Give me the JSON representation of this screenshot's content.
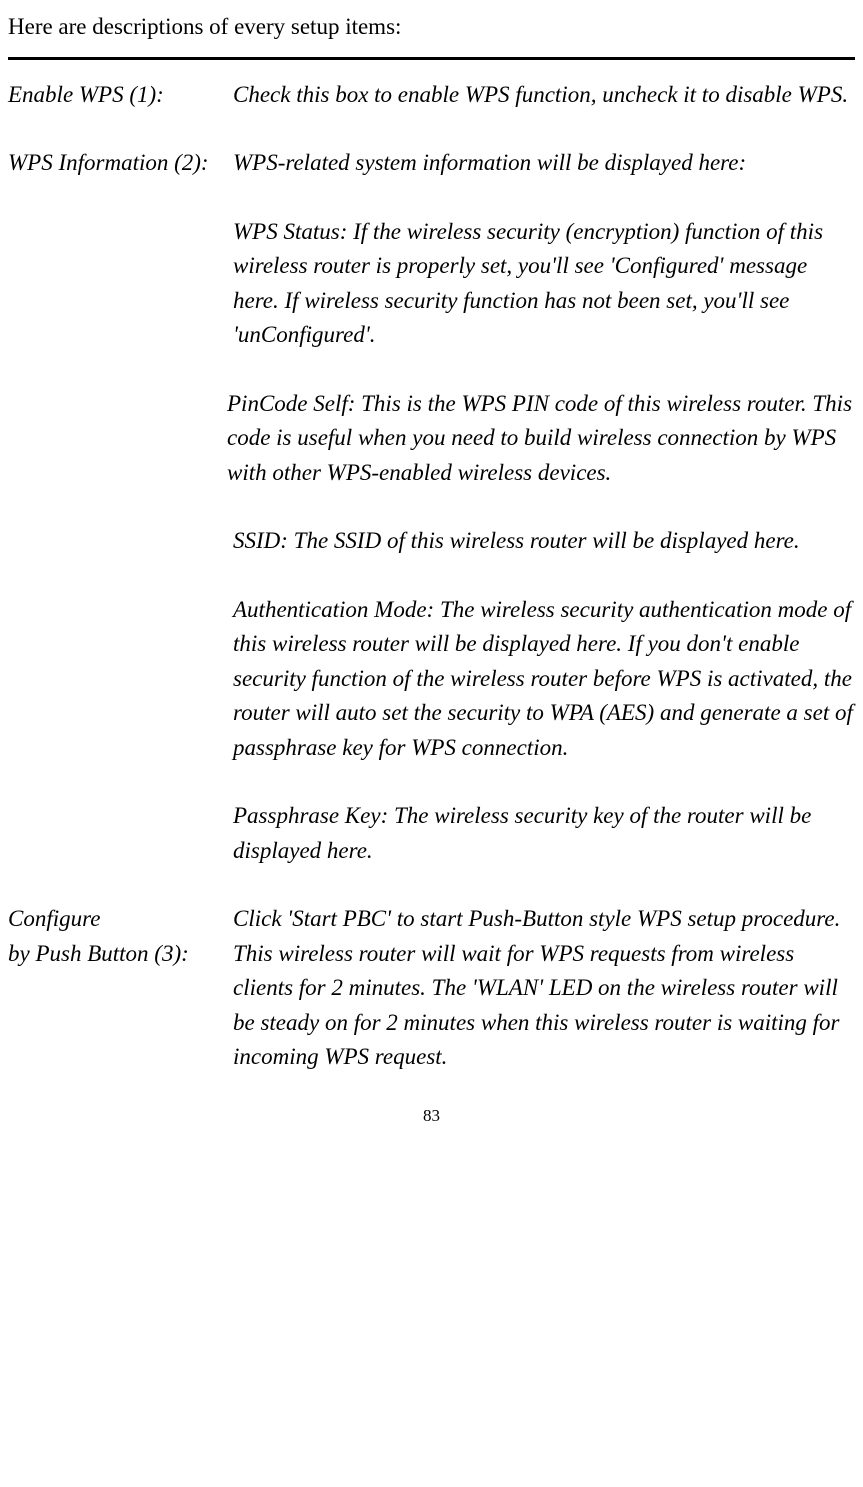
{
  "intro": "Here are descriptions of every setup items:",
  "items": [
    {
      "term": "Enable WPS (1):",
      "def": "Check this box to enable WPS function, uncheck it to disable WPS."
    },
    {
      "term": "WPS Information (2):",
      "def": "WPS-related system information will be displayed here:",
      "subs": [
        "WPS Status: If the wireless security (encryption) function of this wireless router is properly set, you'll see 'Configured' message here. If wireless security function has not been set, you'll see 'unConfigured'.",
        "PinCode Self: This is the WPS PIN code of this wireless router. This code is useful when you need to build wireless connection by WPS with other WPS-enabled wireless devices.",
        "SSID: The SSID of this wireless router will be displayed here.",
        "Authentication Mode: The wireless security authentication mode of this wireless router will be displayed here. If you don't enable security function of the wireless router before WPS is activated, the router will auto set the security to WPA (AES) and generate a set of passphrase key for WPS connection.",
        "Passphrase Key: The wireless security key of the router will be displayed here."
      ]
    },
    {
      "term_lines": [
        "Configure",
        "by Push Button (3):"
      ],
      "def": "Click 'Start PBC' to start Push-Button style WPS setup procedure. This wireless router will wait for WPS requests from wireless clients for 2 minutes. The 'WLAN' LED on the wireless router will be steady on for 2 minutes when this wireless router is waiting for incoming WPS request."
    }
  ],
  "page_number": "83"
}
